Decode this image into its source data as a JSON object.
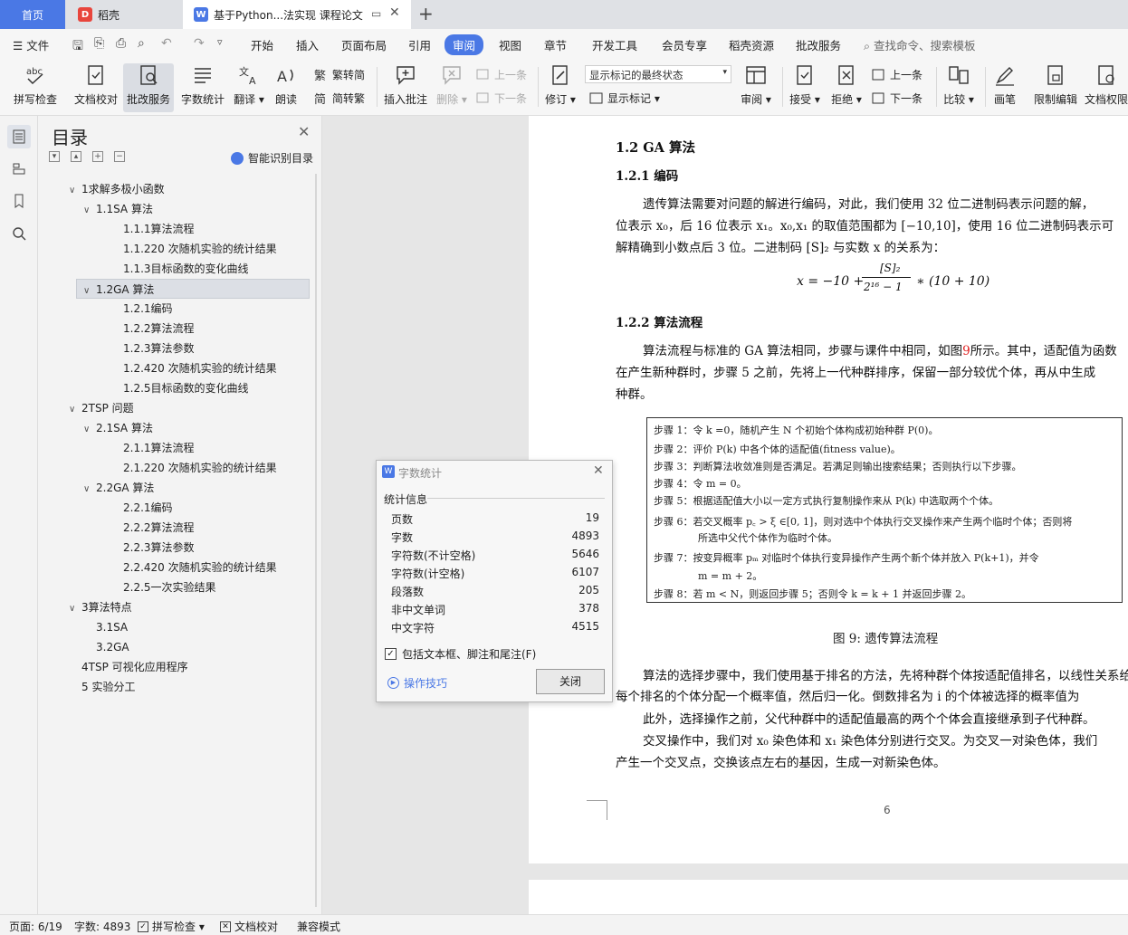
{
  "tabs": {
    "home": "首页",
    "daoke": "稻壳",
    "document": "基于Python...法实现 课程论文"
  },
  "menu": {
    "file": "文件",
    "items": [
      "开始",
      "插入",
      "页面布局",
      "引用",
      "审阅",
      "视图",
      "章节",
      "开发工具",
      "会员专享",
      "稻壳资源",
      "批改服务"
    ],
    "active": "审阅",
    "search": "查找命令、搜索模板"
  },
  "ribbon": {
    "spellcheck": "拼写检查",
    "doc_check": "文档校对",
    "correction_service": "批改服务",
    "word_count": "字数统计",
    "translate": "翻译",
    "read_aloud": "朗读",
    "trad_to_simp": "繁转简",
    "simp_to_trad": "简转繁",
    "insert_comment": "插入批注",
    "delete": "删除",
    "prev": "上一条",
    "next": "下一条",
    "revise": "修订",
    "markup_state": "显示标记的最终状态",
    "show_markup": "显示标记",
    "review": "审阅",
    "accept": "接受",
    "reject": "拒绝",
    "prev2": "上一条",
    "next2": "下一条",
    "compare": "比较",
    "pen": "画笔",
    "restrict_edit": "限制编辑",
    "doc_permission": "文档权限"
  },
  "toc": {
    "title": "目录",
    "smart": "智能识别目录",
    "items": [
      {
        "label": "1求解多极小函数",
        "level": 1,
        "arrow": true
      },
      {
        "label": "1.1SA 算法",
        "level": 2,
        "arrow": true
      },
      {
        "label": "1.1.1算法流程",
        "level": 3,
        "arrow": false
      },
      {
        "label": "1.1.220 次随机实验的统计结果",
        "level": 3,
        "arrow": false
      },
      {
        "label": "1.1.3目标函数的变化曲线",
        "level": 3,
        "arrow": false
      },
      {
        "label": "1.2GA 算法",
        "level": 2,
        "arrow": true,
        "selected": true
      },
      {
        "label": "1.2.1编码",
        "level": 3,
        "arrow": false
      },
      {
        "label": "1.2.2算法流程",
        "level": 3,
        "arrow": false
      },
      {
        "label": "1.2.3算法参数",
        "level": 3,
        "arrow": false
      },
      {
        "label": "1.2.420 次随机实验的统计结果",
        "level": 3,
        "arrow": false
      },
      {
        "label": "1.2.5目标函数的变化曲线",
        "level": 3,
        "arrow": false
      },
      {
        "label": "2TSP 问题",
        "level": 1,
        "arrow": true
      },
      {
        "label": "2.1SA 算法",
        "level": 2,
        "arrow": true
      },
      {
        "label": "2.1.1算法流程",
        "level": 3,
        "arrow": false
      },
      {
        "label": "2.1.220 次随机实验的统计结果",
        "level": 3,
        "arrow": false
      },
      {
        "label": "2.2GA 算法",
        "level": 2,
        "arrow": true
      },
      {
        "label": "2.2.1编码",
        "level": 3,
        "arrow": false
      },
      {
        "label": "2.2.2算法流程",
        "level": 3,
        "arrow": false
      },
      {
        "label": "2.2.3算法参数",
        "level": 3,
        "arrow": false
      },
      {
        "label": "2.2.420 次随机实验的统计结果",
        "level": 3,
        "arrow": false
      },
      {
        "label": "2.2.5一次实验结果",
        "level": 3,
        "arrow": false
      },
      {
        "label": "3算法特点",
        "level": 1,
        "arrow": true
      },
      {
        "label": "3.1SA",
        "level": 2,
        "arrow": false
      },
      {
        "label": "3.2GA",
        "level": 2,
        "arrow": false
      },
      {
        "label": "4TSP 可视化应用程序",
        "level": 1,
        "arrow": false
      },
      {
        "label": "5 实验分工",
        "level": 1,
        "arrow": false
      }
    ]
  },
  "doc": {
    "h_12": "1.2    GA 算法",
    "h_121": "1.2.1    编码",
    "p1_l1": "遗传算法需要对问题的解进行编码，对此，我们使用 32 位二进制码表示问题的解，",
    "p1_l2": "位表示 x₀，后 16 位表示 x₁。x₀,x₁ 的取值范围都为 [−10,10]，使用 16 位二进制码表示可",
    "p1_l3": "解精确到小数点后 3 位。二进制码 [S]₂ 与实数 x 的关系为：",
    "formula": "x = −10 +",
    "formula_num": "[S]₂",
    "formula_den": "2¹⁶ − 1",
    "formula_tail": "∗ (10 + 10)",
    "h_122": "1.2.2    算法流程",
    "p2_l1a": "算法流程与标准的 GA 算法相同，步骤与课件中相同，如图",
    "p2_ref": "9",
    "p2_l1b": "所示。其中，适配值为函数",
    "p2_l2": "在产生新种群时，步骤 5 之前，先将上一代种群排序，保留一部分较优个体，再从中生成",
    "p2_l3": "种群。",
    "algo": [
      "步骤 1：令 k =0，随机产生 N 个初始个体构成初始种群 P(0)。",
      "步骤 2：评价 P(k) 中各个体的适配值(fitness value)。",
      "步骤 3：判断算法收敛准则是否满足。若满足则输出搜索结果；否则执行以下步骤。",
      "步骤 4：令 m = 0。",
      "步骤 5：根据适配值大小以一定方式执行复制操作来从 P(k) 中选取两个个体。",
      "步骤 6：若交叉概率 p꜀ > ξ ∈[0, 1]，则对选中个体执行交叉操作来产生两个临时个体；否则将",
      "所选中父代个体作为临时个体。",
      "步骤 7：按变异概率 pₘ 对临时个体执行变异操作产生两个新个体并放入 P(k+1)，并令",
      "m = m + 2。",
      "步骤 8：若 m < N，则返回步骤 5；否则令 k = k + 1 并返回步骤 2。"
    ],
    "fig_caption": "图 9: 遗传算法流程",
    "p3_l1": "算法的选择步骤中，我们使用基于排名的方法，先将种群个体按适配值排名，以线性关系给",
    "p3_l2": "每个排名的个体分配一个概率值，然后归一化。倒数排名为 i 的个体被选择的概率值为",
    "p4": "此外，选择操作之前，父代种群中的适配值最高的两个个体会直接继承到子代种群。",
    "p5_l1": "交叉操作中，我们对 x₀ 染色体和 x₁ 染色体分别进行交叉。为交叉一对染色体，我们",
    "p5_l2": "产生一个交叉点，交换该点左右的基因，生成一对新染色体。",
    "page_number": "6"
  },
  "dialog": {
    "title": "字数统计",
    "group": "统计信息",
    "stats": [
      {
        "label": "页数",
        "value": "19"
      },
      {
        "label": "字数",
        "value": "4893"
      },
      {
        "label": "字符数(不计空格)",
        "value": "5646"
      },
      {
        "label": "字符数(计空格)",
        "value": "6107"
      },
      {
        "label": "段落数",
        "value": "205"
      },
      {
        "label": "非中文单词",
        "value": "378"
      },
      {
        "label": "中文字符",
        "value": "4515"
      }
    ],
    "include_label": "包括文本框、脚注和尾注(F)",
    "tips": "操作技巧",
    "close": "关闭"
  },
  "status": {
    "page": "页面: 6/19",
    "words": "字数: 4893",
    "spell": "拼写检查",
    "doccheck": "文档校对",
    "compat": "兼容模式"
  },
  "colors": {
    "accent": "#4a78e5",
    "ref_red": "#e02020"
  }
}
